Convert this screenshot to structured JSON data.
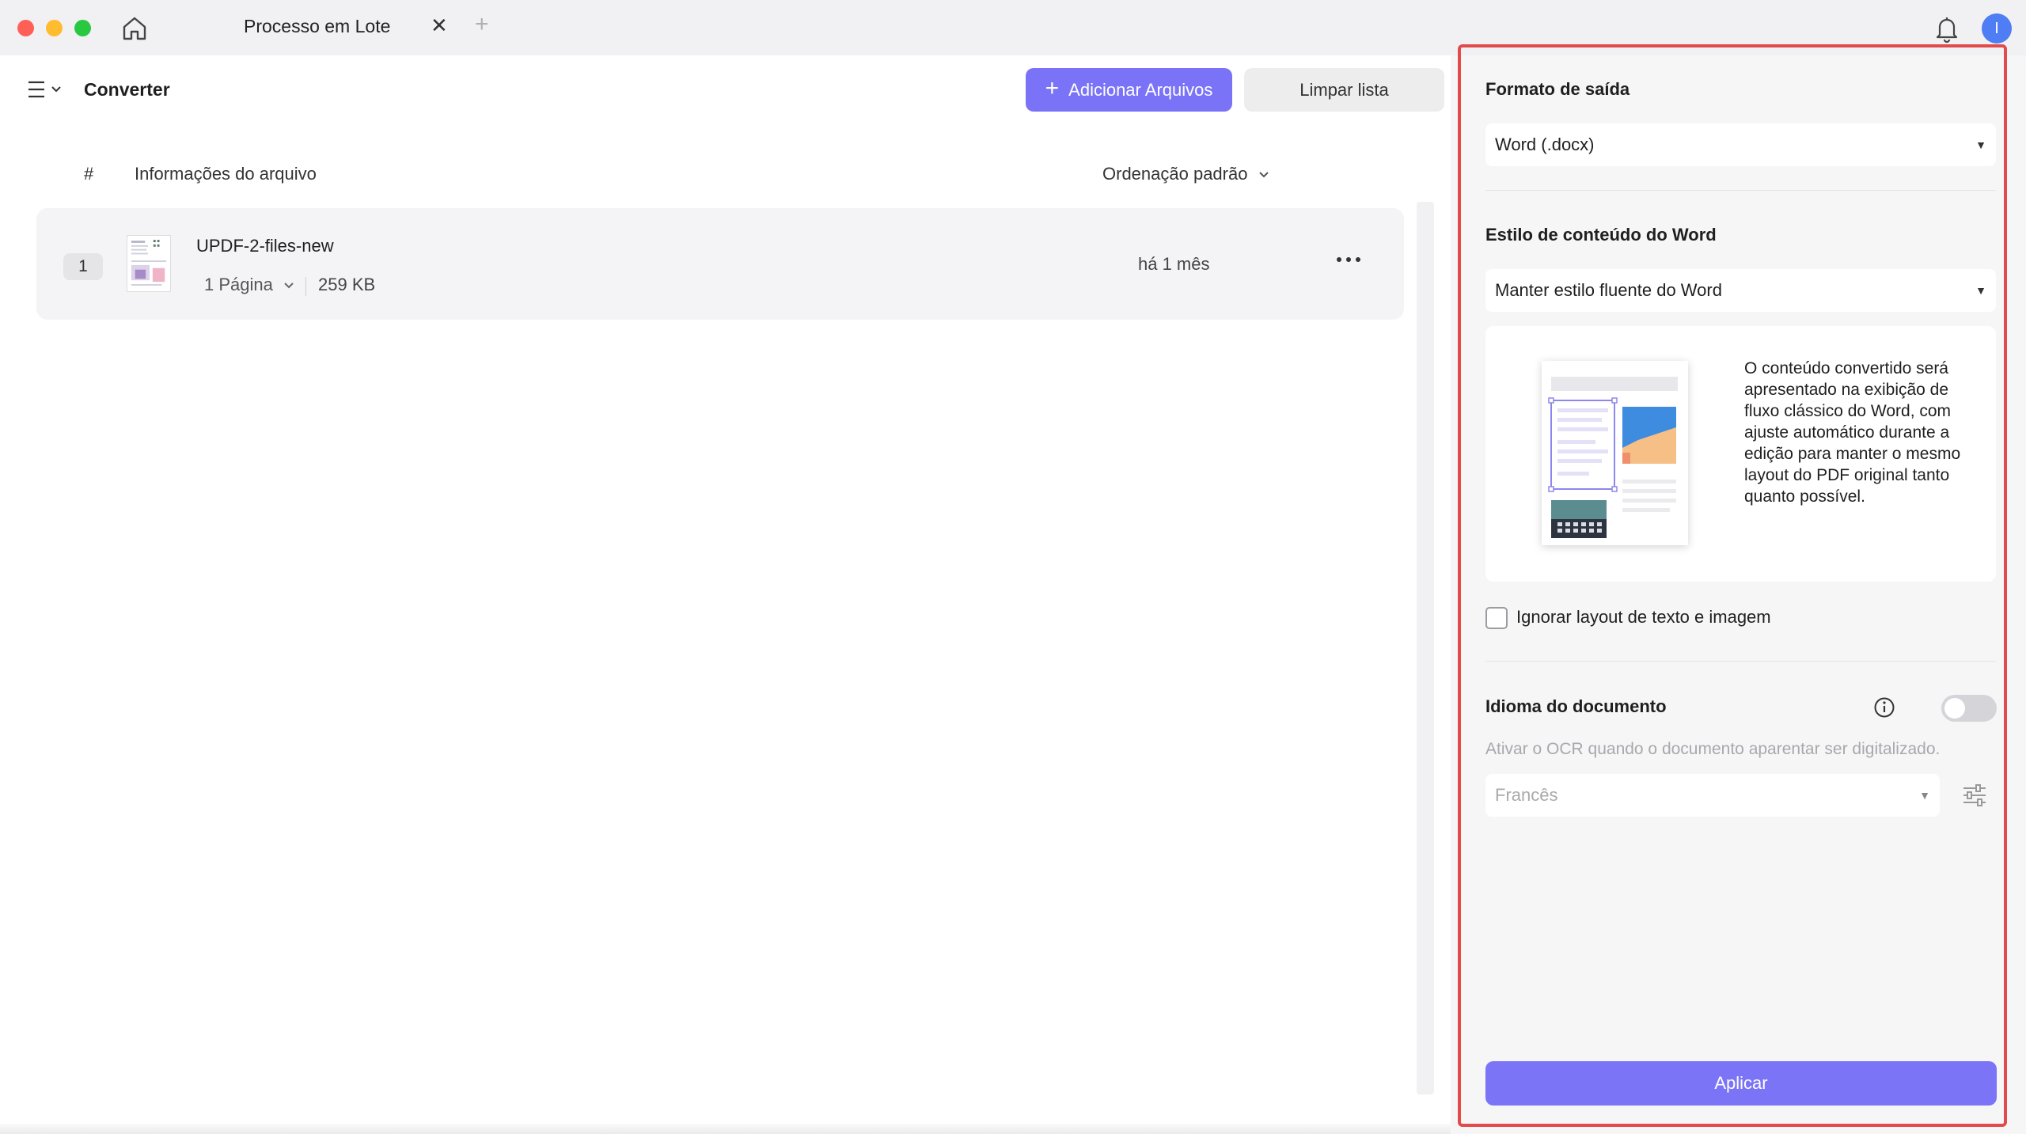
{
  "window": {
    "tab_title": "Processo em Lote",
    "avatar_initial": "I"
  },
  "toolbar": {
    "title": "Converter",
    "add_files_label": "Adicionar Arquivos",
    "clear_list_label": "Limpar lista"
  },
  "file_list": {
    "columns": {
      "index": "#",
      "info": "Informações do arquivo",
      "sort": "Ordenação padrão"
    },
    "files": [
      {
        "index": "1",
        "name": "UPDF-2-files-new",
        "pages": "1 Página",
        "size": "259 KB",
        "date": "há 1 mês"
      }
    ]
  },
  "panel": {
    "output_format": {
      "title": "Formato de saída",
      "value": "Word (.docx)"
    },
    "word_style": {
      "title": "Estilo de conteúdo do Word",
      "value": "Manter estilo fluente do Word",
      "description": "O conteúdo convertido será apresentado na exibição de fluxo clássico do Word, com ajuste automático durante a edição para manter o mesmo layout do PDF original tanto quanto possível."
    },
    "ignore_layout": {
      "label": "Ignorar layout de texto e imagem",
      "checked": false
    },
    "document_language": {
      "title": "Idioma do documento",
      "ocr_enabled": false,
      "hint": "Ativar o OCR quando o documento aparentar ser digitalizado.",
      "value": "Francês"
    },
    "apply_label": "Aplicar"
  },
  "colors": {
    "accent": "#7a73f7",
    "highlight_border": "#e14b4b"
  }
}
